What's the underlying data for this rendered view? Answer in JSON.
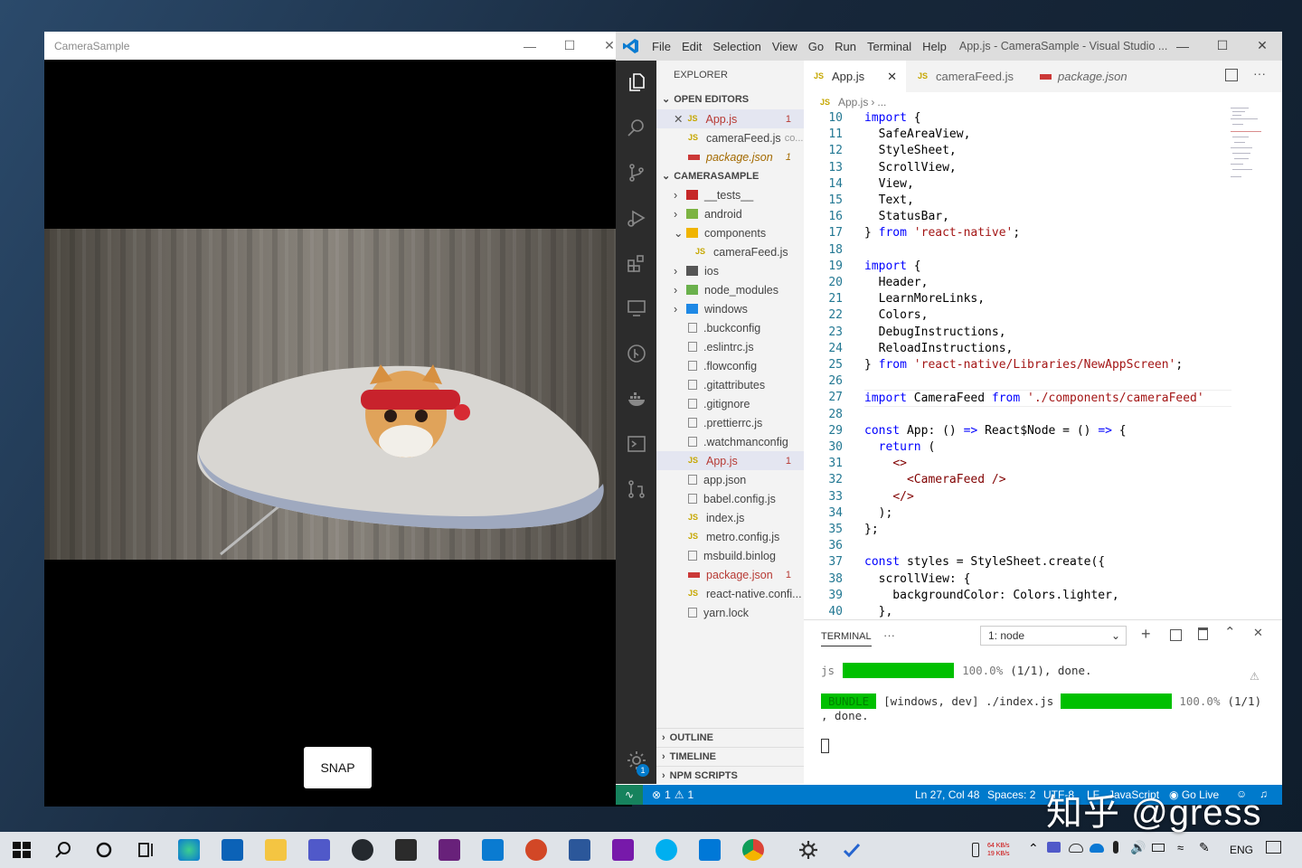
{
  "camera_window": {
    "title": "CameraSample",
    "snap_label": "SNAP"
  },
  "vscode": {
    "menu": [
      "File",
      "Edit",
      "Selection",
      "View",
      "Go",
      "Run",
      "Terminal",
      "Help"
    ],
    "window_title": "App.js - CameraSample - Visual Studio ...",
    "explorer_label": "EXPLORER",
    "open_editors_label": "OPEN EDITORS",
    "open_editors": [
      {
        "name": "App.js",
        "badge": "1",
        "extra": ""
      },
      {
        "name": "cameraFeed.js",
        "badge": "",
        "extra": "co..."
      },
      {
        "name": "package.json",
        "badge": "1",
        "extra": ""
      }
    ],
    "project_label": "CAMERASAMPLE",
    "tree": [
      {
        "name": "__tests__",
        "kind": "folder",
        "badge": ""
      },
      {
        "name": "android",
        "kind": "folder",
        "badge": ""
      },
      {
        "name": "components",
        "kind": "folder-open",
        "badge": ""
      },
      {
        "name": "cameraFeed.js",
        "kind": "js",
        "badge": ""
      },
      {
        "name": "ios",
        "kind": "folder",
        "badge": ""
      },
      {
        "name": "node_modules",
        "kind": "folder",
        "badge": ""
      },
      {
        "name": "windows",
        "kind": "folder",
        "badge": ""
      },
      {
        "name": ".buckconfig",
        "kind": "file",
        "badge": ""
      },
      {
        "name": ".eslintrc.js",
        "kind": "file",
        "badge": ""
      },
      {
        "name": ".flowconfig",
        "kind": "file",
        "badge": ""
      },
      {
        "name": ".gitattributes",
        "kind": "file",
        "badge": ""
      },
      {
        "name": ".gitignore",
        "kind": "file",
        "badge": ""
      },
      {
        "name": ".prettierrc.js",
        "kind": "file",
        "badge": ""
      },
      {
        "name": ".watchmanconfig",
        "kind": "file",
        "badge": ""
      },
      {
        "name": "App.js",
        "kind": "js",
        "badge": "1"
      },
      {
        "name": "app.json",
        "kind": "file",
        "badge": ""
      },
      {
        "name": "babel.config.js",
        "kind": "file",
        "badge": ""
      },
      {
        "name": "index.js",
        "kind": "js",
        "badge": ""
      },
      {
        "name": "metro.config.js",
        "kind": "js",
        "badge": ""
      },
      {
        "name": "msbuild.binlog",
        "kind": "file",
        "badge": ""
      },
      {
        "name": "package.json",
        "kind": "json",
        "badge": "1"
      },
      {
        "name": "react-native.confi...",
        "kind": "js",
        "badge": ""
      },
      {
        "name": "yarn.lock",
        "kind": "file",
        "badge": ""
      }
    ],
    "bottom_sections": [
      "OUTLINE",
      "TIMELINE",
      "NPM SCRIPTS"
    ],
    "tabs": [
      "App.js",
      "cameraFeed.js",
      "package.json"
    ],
    "breadcrumb": [
      "App.js",
      "..."
    ],
    "code_lines": [
      {
        "n": "10",
        "t": "import {"
      },
      {
        "n": "11",
        "t": "  SafeAreaView,"
      },
      {
        "n": "12",
        "t": "  StyleSheet,"
      },
      {
        "n": "13",
        "t": "  ScrollView,"
      },
      {
        "n": "14",
        "t": "  View,"
      },
      {
        "n": "15",
        "t": "  Text,"
      },
      {
        "n": "16",
        "t": "  StatusBar,"
      },
      {
        "n": "17",
        "t": "} from 'react-native';"
      },
      {
        "n": "18",
        "t": ""
      },
      {
        "n": "19",
        "t": "import {"
      },
      {
        "n": "20",
        "t": "  Header,"
      },
      {
        "n": "21",
        "t": "  LearnMoreLinks,"
      },
      {
        "n": "22",
        "t": "  Colors,"
      },
      {
        "n": "23",
        "t": "  DebugInstructions,"
      },
      {
        "n": "24",
        "t": "  ReloadInstructions,"
      },
      {
        "n": "25",
        "t": "} from 'react-native/Libraries/NewAppScreen';"
      },
      {
        "n": "26",
        "t": ""
      },
      {
        "n": "27",
        "t": "import CameraFeed from './components/cameraFeed'"
      },
      {
        "n": "28",
        "t": ""
      },
      {
        "n": "29",
        "t": "const App: () => React$Node = () => {"
      },
      {
        "n": "30",
        "t": "  return ("
      },
      {
        "n": "31",
        "t": "    <>"
      },
      {
        "n": "32",
        "t": "      <CameraFeed />"
      },
      {
        "n": "33",
        "t": "    </>"
      },
      {
        "n": "34",
        "t": "  );"
      },
      {
        "n": "35",
        "t": "};"
      },
      {
        "n": "36",
        "t": ""
      },
      {
        "n": "37",
        "t": "const styles = StyleSheet.create({"
      },
      {
        "n": "38",
        "t": "  scrollView: {"
      },
      {
        "n": "39",
        "t": "    backgroundColor: Colors.lighter,"
      },
      {
        "n": "40",
        "t": "  },"
      }
    ],
    "terminal": {
      "label": "TERMINAL",
      "more": "···",
      "select": "1: node",
      "line1_prefix": "js",
      "line1_pct": "100.0%",
      "line1_rest": "(1/1), done.",
      "bundle_tag": "BUNDLE",
      "line2_mid": "[windows, dev] ./index.js",
      "line2_pct": "100.0%",
      "line2_rest": "(1/1)",
      "line3": ", done."
    },
    "status": {
      "errors": "1",
      "warnings": "1",
      "cursor": "Ln 27, Col 48",
      "spaces": "Spaces: 2",
      "encoding": "UTF-8",
      "eol": "LF",
      "language": "JavaScript",
      "golive": "Go Live"
    },
    "settings_badge": "1"
  },
  "taskbar": {
    "lang": "ENG",
    "net_up": "64 KB/s",
    "net_down": "19 KB/s"
  },
  "watermark": "知乎 @gress",
  "colors": {
    "accent": "#007acc",
    "progress": "#00c000",
    "code_keyword": "#0000ff",
    "code_string": "#a31515"
  }
}
